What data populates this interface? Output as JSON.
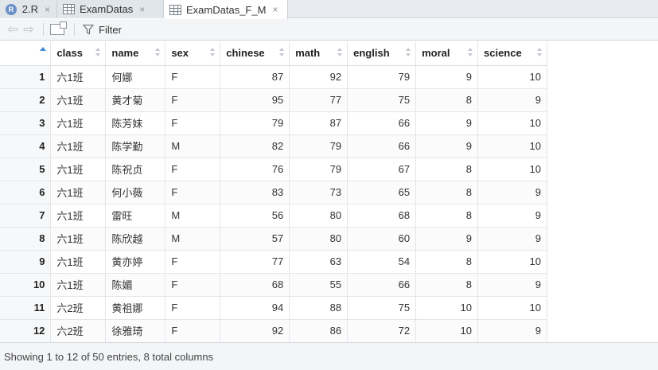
{
  "tabs": [
    {
      "label": "2.R",
      "icon": "r-script-icon",
      "active": false,
      "close": "×"
    },
    {
      "label": "ExamDatas",
      "icon": "data-grid-icon",
      "active": false,
      "close": "×"
    },
    {
      "label": "ExamDatas_F_M",
      "icon": "data-grid-icon",
      "active": true,
      "close": "×"
    }
  ],
  "toolbar": {
    "filter_label": "Filter"
  },
  "table": {
    "columns": [
      "class",
      "name",
      "sex",
      "chinese",
      "math",
      "english",
      "moral",
      "science"
    ],
    "rows": [
      [
        "1",
        "六1班",
        "何娜",
        "F",
        "87",
        "92",
        "79",
        "9",
        "10"
      ],
      [
        "2",
        "六1班",
        "黄才菊",
        "F",
        "95",
        "77",
        "75",
        "8",
        "9"
      ],
      [
        "3",
        "六1班",
        "陈芳妹",
        "F",
        "79",
        "87",
        "66",
        "9",
        "10"
      ],
      [
        "4",
        "六1班",
        "陈学勤",
        "M",
        "82",
        "79",
        "66",
        "9",
        "10"
      ],
      [
        "5",
        "六1班",
        "陈祝贞",
        "F",
        "76",
        "79",
        "67",
        "8",
        "10"
      ],
      [
        "6",
        "六1班",
        "何小薇",
        "F",
        "83",
        "73",
        "65",
        "8",
        "9"
      ],
      [
        "7",
        "六1班",
        "雷旺",
        "M",
        "56",
        "80",
        "68",
        "8",
        "9"
      ],
      [
        "8",
        "六1班",
        "陈欣越",
        "M",
        "57",
        "80",
        "60",
        "9",
        "9"
      ],
      [
        "9",
        "六1班",
        "黄亦婷",
        "F",
        "77",
        "63",
        "54",
        "8",
        "10"
      ],
      [
        "10",
        "六1班",
        "陈媚",
        "F",
        "68",
        "55",
        "66",
        "8",
        "9"
      ],
      [
        "11",
        "六2班",
        "黄祖娜",
        "F",
        "94",
        "88",
        "75",
        "10",
        "10"
      ],
      [
        "12",
        "六2班",
        "徐雅琦",
        "F",
        "92",
        "86",
        "72",
        "10",
        "9"
      ]
    ]
  },
  "status": {
    "text": "Showing 1 to 12 of 50 entries, 8 total columns"
  },
  "colors": {
    "accent": "#3f8cd6",
    "tabbar_bg": "#e7ebef",
    "toolbar_bg": "#f3f5f7"
  }
}
